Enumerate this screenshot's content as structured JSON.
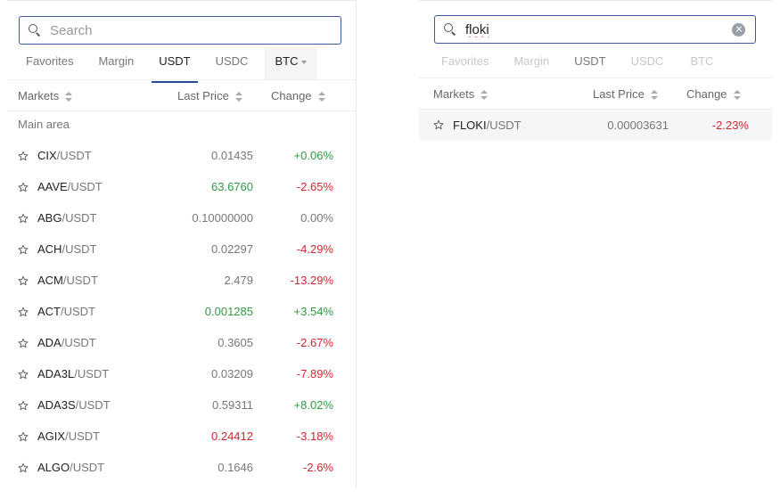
{
  "left": {
    "search": {
      "placeholder": "Search",
      "value": ""
    },
    "tabs": [
      {
        "label": "Favorites"
      },
      {
        "label": "Margin"
      },
      {
        "label": "USDT",
        "active": true
      },
      {
        "label": "USDC"
      },
      {
        "label": "BTC"
      }
    ],
    "headers": {
      "markets": "Markets",
      "last_price": "Last Price",
      "change": "Change"
    },
    "section_label": "Main area",
    "rows": [
      {
        "base": "CIX",
        "quote": "/USDT",
        "price": "0.01435",
        "price_color": "neutral",
        "change": "+0.06%",
        "change_color": "green"
      },
      {
        "base": "AAVE",
        "quote": "/USDT",
        "price": "63.6760",
        "price_color": "green",
        "change": "-2.65%",
        "change_color": "red"
      },
      {
        "base": "ABG",
        "quote": "/USDT",
        "price": "0.10000000",
        "price_color": "neutral",
        "change": "0.00%",
        "change_color": "neutral"
      },
      {
        "base": "ACH",
        "quote": "/USDT",
        "price": "0.02297",
        "price_color": "neutral",
        "change": "-4.29%",
        "change_color": "red"
      },
      {
        "base": "ACM",
        "quote": "/USDT",
        "price": "2.479",
        "price_color": "neutral",
        "change": "-13.29%",
        "change_color": "red"
      },
      {
        "base": "ACT",
        "quote": "/USDT",
        "price": "0.001285",
        "price_color": "green",
        "change": "+3.54%",
        "change_color": "green"
      },
      {
        "base": "ADA",
        "quote": "/USDT",
        "price": "0.3605",
        "price_color": "neutral",
        "change": "-2.67%",
        "change_color": "red"
      },
      {
        "base": "ADA3L",
        "quote": "/USDT",
        "price": "0.03209",
        "price_color": "neutral",
        "change": "-7.89%",
        "change_color": "red"
      },
      {
        "base": "ADA3S",
        "quote": "/USDT",
        "price": "0.59311",
        "price_color": "neutral",
        "change": "+8.02%",
        "change_color": "green"
      },
      {
        "base": "AGIX",
        "quote": "/USDT",
        "price": "0.24412",
        "price_color": "red",
        "change": "-3.18%",
        "change_color": "red"
      },
      {
        "base": "ALGO",
        "quote": "/USDT",
        "price": "0.1646",
        "price_color": "neutral",
        "change": "-2.6%",
        "change_color": "red"
      }
    ]
  },
  "right": {
    "search": {
      "placeholder": "Search",
      "value": "floki"
    },
    "tabs": [
      {
        "label": "Favorites"
      },
      {
        "label": "Margin"
      },
      {
        "label": "USDT",
        "active": true
      },
      {
        "label": "USDC"
      },
      {
        "label": "BTC"
      }
    ],
    "headers": {
      "markets": "Markets",
      "last_price": "Last Price",
      "change": "Change"
    },
    "rows": [
      {
        "base": "FLOKI",
        "quote": "/USDT",
        "price": "0.00003631",
        "price_color": "neutral",
        "change": "-2.23%",
        "change_color": "red"
      }
    ]
  },
  "colors": {
    "green": "#2f9a41",
    "red": "#d0272f",
    "accent": "#2a4a94"
  }
}
